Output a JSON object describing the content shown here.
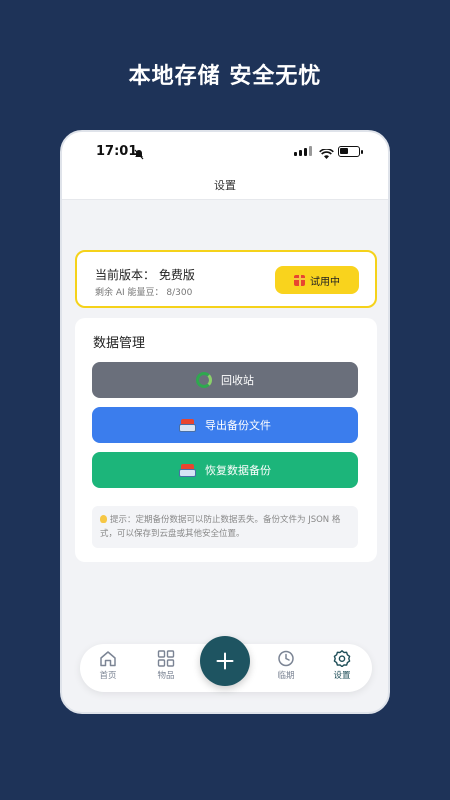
{
  "headline": "本地存储  安全无忧",
  "status": {
    "time": "17:01"
  },
  "nav": {
    "title": "设置"
  },
  "version": {
    "label": "当前版本：  免费版",
    "ai_balance": "剩余 AI 能量豆：  8/300",
    "trial_button": "试用中"
  },
  "data_management": {
    "title": "数据管理",
    "recycle_button": "回收站",
    "export_button": "导出备份文件",
    "restore_button": "恢复数据备份",
    "tip": "提示：定期备份数据可以防止数据丢失。备份文件为 JSON 格式，可以保存到云盘或其他安全位置。"
  },
  "tabs": {
    "home": "首页",
    "items": "物品",
    "expiring": "临期",
    "settings": "设置"
  },
  "colors": {
    "background": "#1e3358",
    "recycle": "#6a6f7b",
    "export": "#3b7ded",
    "restore": "#1cb57a",
    "trial": "#f9d31d",
    "fab": "#1e5461"
  }
}
